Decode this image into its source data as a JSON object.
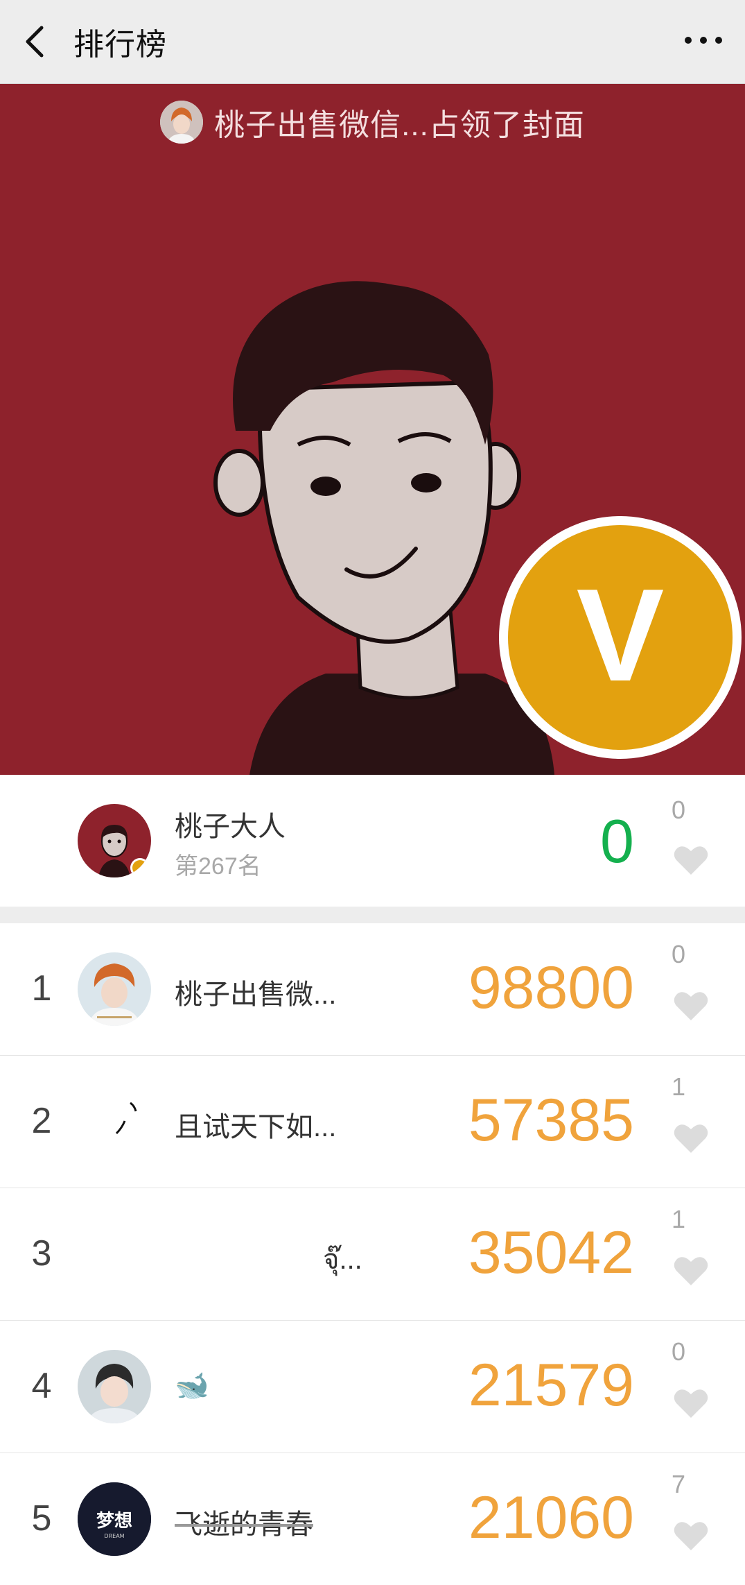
{
  "nav": {
    "title": "排行榜",
    "back_icon": "chevron-left-icon",
    "more_icon": "more-dots-icon"
  },
  "cover": {
    "caption": "桃子出售微信...占领了封面",
    "background_color": "#8e222c",
    "badge_letter": "V"
  },
  "me": {
    "name": "桃子大人",
    "rank": "第267名",
    "score": "0",
    "likes": "0",
    "score_color": "#14b04e"
  },
  "colors": {
    "score": "#f0a33c",
    "heart": "#dcdcdc"
  },
  "ranking": [
    {
      "rank": "1",
      "name": "桃子出售微...",
      "score": "98800",
      "likes": "0",
      "avatar": "anime-boy-avatar"
    },
    {
      "rank": "2",
      "name": "且试天下如...",
      "score": "57385",
      "likes": "1",
      "avatar": "ink-brush-avatar"
    },
    {
      "rank": "3",
      "name": "จุ๊...",
      "score": "35042",
      "likes": "1",
      "avatar": "blank-avatar"
    },
    {
      "rank": "4",
      "name": "🐋",
      "score": "21579",
      "likes": "0",
      "avatar": "photo-avatar"
    },
    {
      "rank": "5",
      "name": "飞逝的青春",
      "score": "21060",
      "likes": "7",
      "avatar": "dream-logo-avatar"
    }
  ]
}
